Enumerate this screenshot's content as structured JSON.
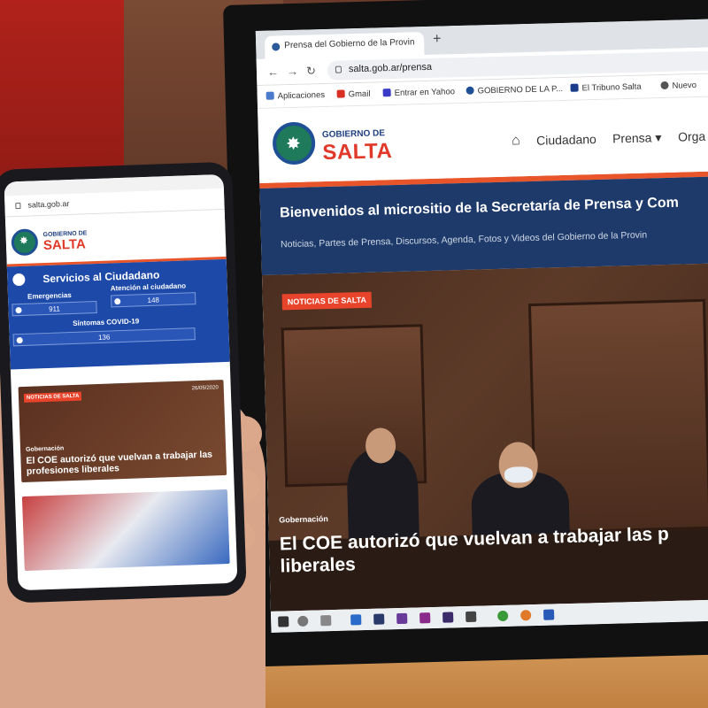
{
  "browser": {
    "tab_title": "Prensa del Gobierno de la Provin",
    "url": "salta.gob.ar/prensa",
    "bookmarks": [
      "Aplicaciones",
      "Gmail",
      "Entrar en Yahoo",
      "GOBIERNO DE LA P...",
      "El Tribuno Salta",
      "Nuevo"
    ]
  },
  "site": {
    "logo_small": "GOBIERNO DE",
    "logo_large": "SALTA",
    "nav": [
      "Ciudadano",
      "Prensa ▾",
      "Orga"
    ],
    "banner_title": "Bienvenidos al micrositio de la Secretaría de Prensa y Com",
    "banner_subtitle": "Noticias, Partes de Prensa, Discursos, Agenda, Fotos y Videos del Gobierno de la Provin",
    "hero": {
      "badge": "NOTICIAS DE SALTA",
      "category": "Gobernación",
      "title": "El COE autorizó que vuelvan a trabajar las p liberales"
    }
  },
  "phone": {
    "url": "salta.gob.ar",
    "logo_small": "GOBIERNO DE",
    "logo_large": "SALTA",
    "services_title": "Servicios al Ciudadano",
    "services": [
      {
        "label": "Emergencias",
        "value": "911"
      },
      {
        "label": "Atención al ciudadano",
        "value": "148"
      },
      {
        "label": "Síntomas COVID-19",
        "value": "136"
      }
    ],
    "news": {
      "badge": "NOTICIAS DE SALTA",
      "date": "26/05/2020",
      "category": "Gobernación",
      "title": "El COE autorizó que vuelvan a trabajar las profesiones liberales"
    }
  },
  "colors": {
    "brand_blue": "#1d3a6a",
    "brand_red": "#e0392a",
    "accent_orange": "#e8552b"
  }
}
